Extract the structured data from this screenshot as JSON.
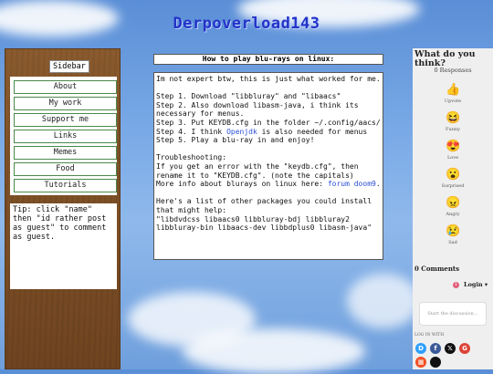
{
  "site": {
    "title": "Derpoverload143"
  },
  "sidebar": {
    "title": "Sidebar",
    "items": [
      {
        "label": "About"
      },
      {
        "label": "My work"
      },
      {
        "label": "Support me"
      },
      {
        "label": "Links"
      },
      {
        "label": "Memes"
      },
      {
        "label": "Food"
      },
      {
        "label": "Tutorials"
      }
    ],
    "tip": "Tip: click \"name\" then \"id rather post as guest\" to comment as guest."
  },
  "post": {
    "title": "How to play blu-rays on linux:",
    "intro": "Im not expert btw, this is just what worked for me.",
    "steps": [
      "Step 1. Download \"libbluray\" and \"libaacs\"",
      "Step 2. Also download libasm-java, i think its necessary for menus.",
      "Step 3. Put KEYDB.cfg in the folder ~/.config/aacs/",
      "Step 4. I think ",
      "Step 5. Play a blu-ray in and enjoy!"
    ],
    "step4_link": "Openjdk",
    "step4_after": " is also needed for menus",
    "troubleshooting": "Troubleshooting:",
    "trouble1": "If you get an error with the \"keydb.cfg\", then rename it to \"KEYDB.cfg\". (note the capitals)",
    "more_info": "More info about blurays on linux here: ",
    "forum_link": "forum doom9",
    "more_info_end": ".",
    "packages_intro": "Here's a list of other packages you could install that might help:",
    "packages": "\"libdvdcss libaacs0 libbluray-bdj libbluray2 libbluray-bin libaacs-dev libbdplus0 libasm-java\""
  },
  "comments": {
    "question": "What do you think?",
    "responses": "0 Responses",
    "reactions": [
      {
        "label": "Upvote",
        "icon": "thumbs-up-icon",
        "glyph": "👍",
        "color": "#f5c542"
      },
      {
        "label": "Funny",
        "icon": "laughing-face-icon",
        "glyph": "😆",
        "color": "#f5c542"
      },
      {
        "label": "Love",
        "icon": "heart-eyes-icon",
        "glyph": "😍",
        "color": "#f5c542"
      },
      {
        "label": "Surprised",
        "icon": "surprised-face-icon",
        "glyph": "😮",
        "color": "#f5c542"
      },
      {
        "label": "Angry",
        "icon": "angry-face-icon",
        "glyph": "😠",
        "color": "#f5a042"
      },
      {
        "label": "Sad",
        "icon": "sad-face-icon",
        "glyph": "😢",
        "color": "#f5c542"
      }
    ],
    "count": "0 Comments",
    "notif_count": "1",
    "login": "Login ▾",
    "placeholder": "Start the discussion…",
    "login_with": "LOG IN WITH",
    "social": [
      {
        "name": "disqus-icon",
        "glyph": "D",
        "color": "#2e9fff"
      },
      {
        "name": "facebook-icon",
        "glyph": "f",
        "color": "#3b5998"
      },
      {
        "name": "x-icon",
        "glyph": "𝕏",
        "color": "#111111"
      },
      {
        "name": "google-icon",
        "glyph": "G",
        "color": "#db4437"
      },
      {
        "name": "microsoft-icon",
        "glyph": "▦",
        "color": "#f25022"
      },
      {
        "name": "apple-icon",
        "glyph": "",
        "color": "#111111"
      }
    ]
  }
}
